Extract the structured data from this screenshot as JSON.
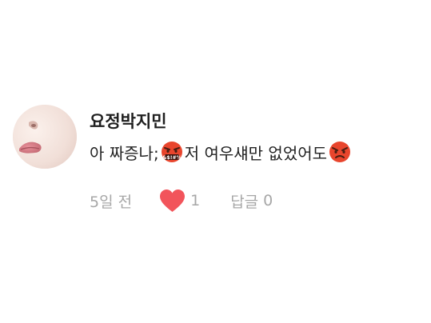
{
  "comment": {
    "username": "요정박지민",
    "text_part1": "아 짜증나;",
    "text_part2": " 저 여우섀만 없었어도",
    "emoji_cursing_text": "&$!#%",
    "time": "5일 전",
    "like_count": "1",
    "reply_label": "답글",
    "reply_count": "0",
    "icons": {
      "cursing_face": "face-with-symbols-on-mouth-icon",
      "angry_face": "angry-face-icon",
      "heart": "heart-icon"
    },
    "colors": {
      "heart": "#f2545b",
      "muted_text": "#a7a7a7",
      "emoji_face": "#e8452d"
    }
  }
}
